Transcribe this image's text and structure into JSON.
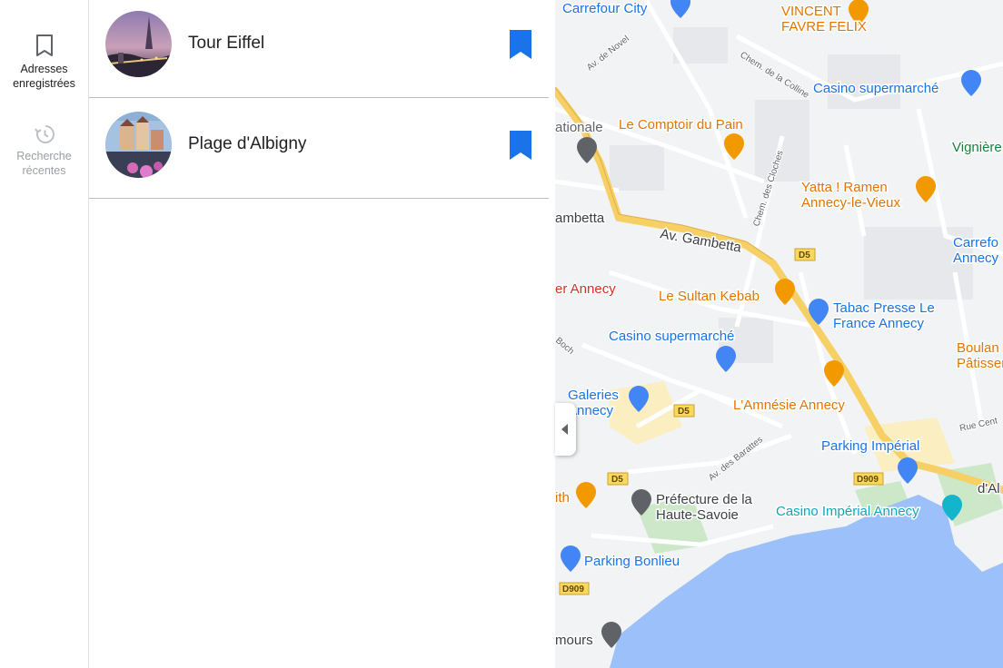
{
  "sidebar": {
    "items": [
      {
        "label": "Adresses\nenregistrées",
        "icon": "bookmark-outline-icon",
        "active": true
      },
      {
        "label": "Recherche\nrécentes",
        "icon": "history-icon",
        "active": false
      }
    ]
  },
  "saved_places": [
    {
      "title": "Tour Eiffel",
      "bookmark_icon": "bookmark-filled-icon"
    },
    {
      "title": "Plage d'Albigny",
      "bookmark_icon": "bookmark-filled-icon"
    }
  ],
  "map": {
    "labels": {
      "carrefour_city": "Carrefour City",
      "vincent": "VINCENT\nFAVRE FELIX",
      "casino1": "Casino supermarché",
      "vigniere": "Vignière",
      "comptoir": "Le Comptoir du Pain",
      "nationale": "ationale",
      "yatta": "Yatta ! Ramen\nAnnecy-le-Vieux",
      "carrefour2": "Carrefo\nAnnecy",
      "gambetta": "ambetta",
      "av_gambetta": "Av. Gambetta",
      "er_annecy": "er Annecy",
      "sultan": "Le Sultan Kebab",
      "tabac": "Tabac Presse Le\nFrance Annecy",
      "casino2": "Casino supermarché",
      "boulan": "Boulan\nPâtisserie Pan &",
      "galeries": "Galeries\nAnnecy",
      "amnesie": "L'Amnésie Annecy",
      "parking_imperial": "Parking Impérial",
      "rue_cent": "Rue Cent",
      "dal": "d'Al",
      "ith": "ith",
      "prefecture": "Préfecture de la\nHaute-Savoie",
      "casino_imperial": "Casino Impérial Annecy",
      "parking_bonlieu": "Parking Bonlieu",
      "mours": "mours",
      "av_novel": "Av. de Novel",
      "chem_colline": "Chem. de la Colline",
      "chem_cloches": "Chem. des Cloches",
      "av_barattes": "Av. des Barattes",
      "boch": "Boch",
      "d5": "D5",
      "d909": "D909"
    },
    "colors": {
      "road_major": "#f6cf65",
      "road_minor": "#ffffff",
      "water": "#9cc0f9",
      "park": "#cde8c9",
      "food_poi": "#f29900",
      "shop_poi": "#4285f4",
      "civic_poi": "#5f6368",
      "casino_poi": "#12b5cb"
    }
  }
}
